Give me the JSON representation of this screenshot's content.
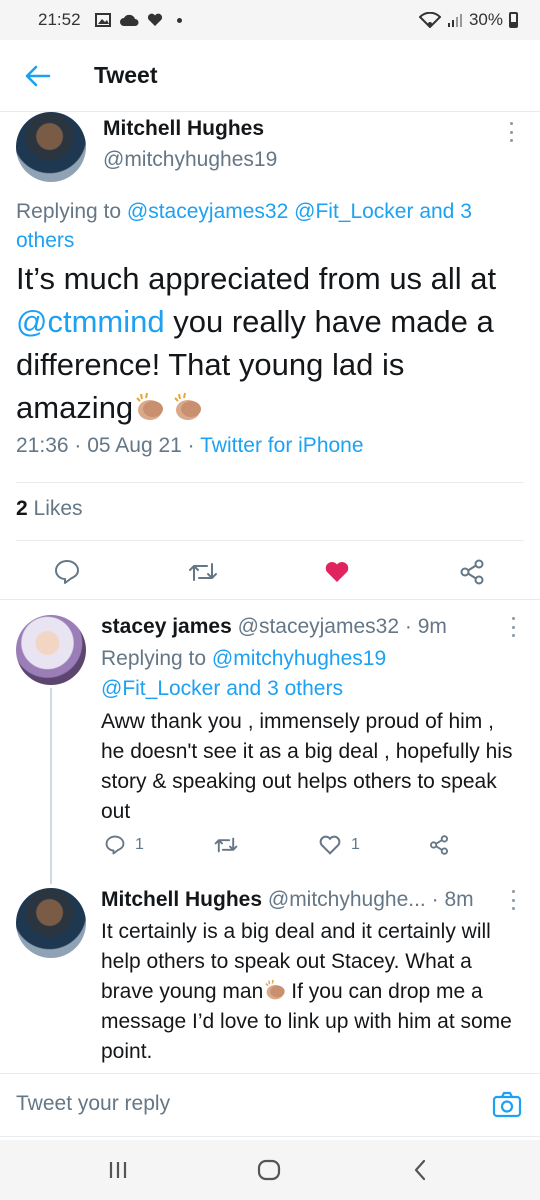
{
  "status_bar": {
    "time": "21:52",
    "battery": "30%"
  },
  "header": {
    "title": "Tweet"
  },
  "main_tweet": {
    "name": "Mitchell Hughes",
    "handle": "@mitchyhughes19",
    "replying_prefix": "Replying to",
    "replying_users": "@staceyjames32 @Fit_Locker",
    "replying_others": "and 3 others",
    "body_part1": "It’s much appreciated from us all at",
    "body_mention": "@ctmmind",
    "body_part2": "you really have made a difference! That young lad is amazing",
    "time": "21:36",
    "date": "05 Aug 21",
    "source": "Twitter for iPhone",
    "likes_count": "2",
    "likes_label": "Likes"
  },
  "replies": [
    {
      "name": "stacey james",
      "handle": "@staceyjames32",
      "time": "9m",
      "replying_prefix": "Replying to",
      "replying_users": "@mitchyhughes19 @Fit_Locker",
      "replying_others": "and 3 others",
      "text": "Aww thank you , immensely proud of him , he doesn't see it as a big deal , hopefully his story & speaking out helps others to speak out",
      "reply_count": "1",
      "like_count": "1"
    },
    {
      "name": "Mitchell Hughes",
      "handle": "@mitchyhughe...",
      "time": "8m",
      "text_part1": "It certainly is a big deal and it certainly will help others to speak out Stacey. What a brave young man",
      "text_part2": "If you can drop me a message I’d love to link up with him at some point."
    }
  ],
  "reply_box": {
    "placeholder": "Tweet your reply"
  },
  "colors": {
    "accent": "#1da1f2",
    "like": "#e0245e",
    "secondary": "#657786"
  },
  "icons": [
    "back-arrow-icon",
    "more-icon",
    "reply-icon",
    "retweet-icon",
    "heart-icon",
    "share-icon",
    "camera-icon",
    "clap-emoji"
  ]
}
